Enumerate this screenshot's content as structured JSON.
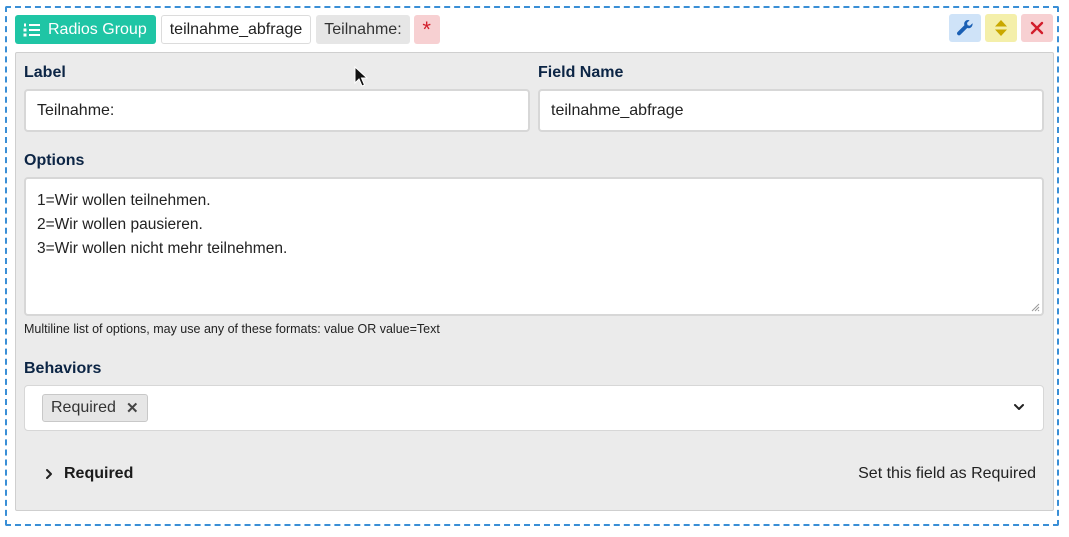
{
  "header": {
    "type_label": "Radios Group",
    "type_icon": "list-ordered-icon",
    "field_name_chip": "teilnahme_abfrage",
    "label_chip": "Teilnahme:",
    "required_marker": "*",
    "accent_color": "#1fc5a5"
  },
  "actions": {
    "settings_icon": "wrench-icon",
    "move_icon": "sort-icon",
    "delete_icon": "close-icon"
  },
  "form": {
    "label": {
      "title": "Label",
      "value": "Teilnahme:"
    },
    "field_name": {
      "title": "Field Name",
      "value": "teilnahme_abfrage"
    },
    "options": {
      "title": "Options",
      "lines": [
        "1=Wir wollen teilnehmen.",
        "2=Wir wollen pausieren.",
        "3=Wir wollen nicht mehr teilnehmen."
      ],
      "help": "Multiline list of options, may use any of these formats: value OR value=Text"
    },
    "behaviors": {
      "title": "Behaviors",
      "selected": [
        "Required"
      ],
      "remove_glyph": "✕"
    },
    "behavior_rows": [
      {
        "title": "Required",
        "description": "Set this field as Required"
      }
    ]
  }
}
